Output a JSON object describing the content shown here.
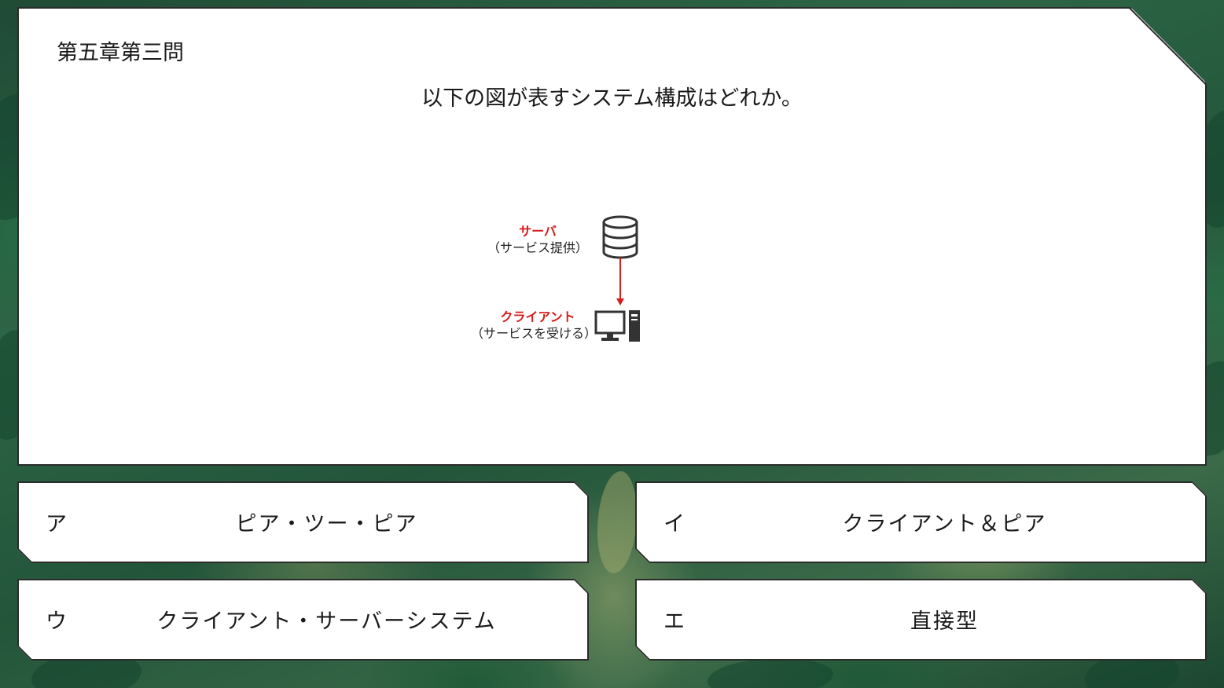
{
  "chapter": "第五章第三問",
  "question": "以下の図が表すシステム構成はどれか。",
  "diagram": {
    "server_title": "サーバ",
    "server_sub": "（サービス提供）",
    "client_title": "クライアント",
    "client_sub": "（サービスを受ける）",
    "accent_color": "#d81b1b",
    "server_icon": "database-icon",
    "client_icon": "desktop-computer-icon"
  },
  "choices": [
    {
      "letter": "ア",
      "label": "ピア・ツー・ピア"
    },
    {
      "letter": "イ",
      "label": "クライアント＆ピア"
    },
    {
      "letter": "ウ",
      "label": "クライアント・サーバーシステム"
    },
    {
      "letter": "エ",
      "label": "直接型"
    }
  ]
}
